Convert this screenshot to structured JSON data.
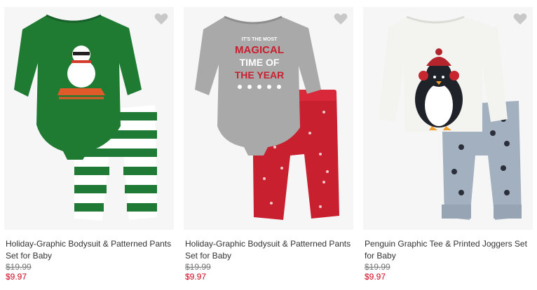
{
  "colors": {
    "sale_price": "#d0021b",
    "original_price": "#777777",
    "title": "#333333",
    "favorite_icon": "#c8c8c8"
  },
  "products": [
    {
      "title_line1": "Holiday-Graphic Bodysuit & Patterned Pants",
      "title_line2": "Set for Baby",
      "original_price": "$19.99",
      "sale_price": "$9.97",
      "favorite_icon": "heart-icon"
    },
    {
      "title_line1": "Holiday-Graphic Bodysuit & Patterned Pants",
      "title_line2": "Set for Baby",
      "original_price": "$19.99",
      "sale_price": "$9.97",
      "favorite_icon": "heart-icon",
      "graphic_text": [
        "IT'S THE MOST",
        "MAGICAL",
        "TIME OF",
        "THE YEAR"
      ]
    },
    {
      "title_line1": "Penguin Graphic Tee & Printed Joggers Set",
      "title_line2": "for Baby",
      "original_price": "$19.99",
      "sale_price": "$9.97",
      "favorite_icon": "heart-icon"
    }
  ]
}
